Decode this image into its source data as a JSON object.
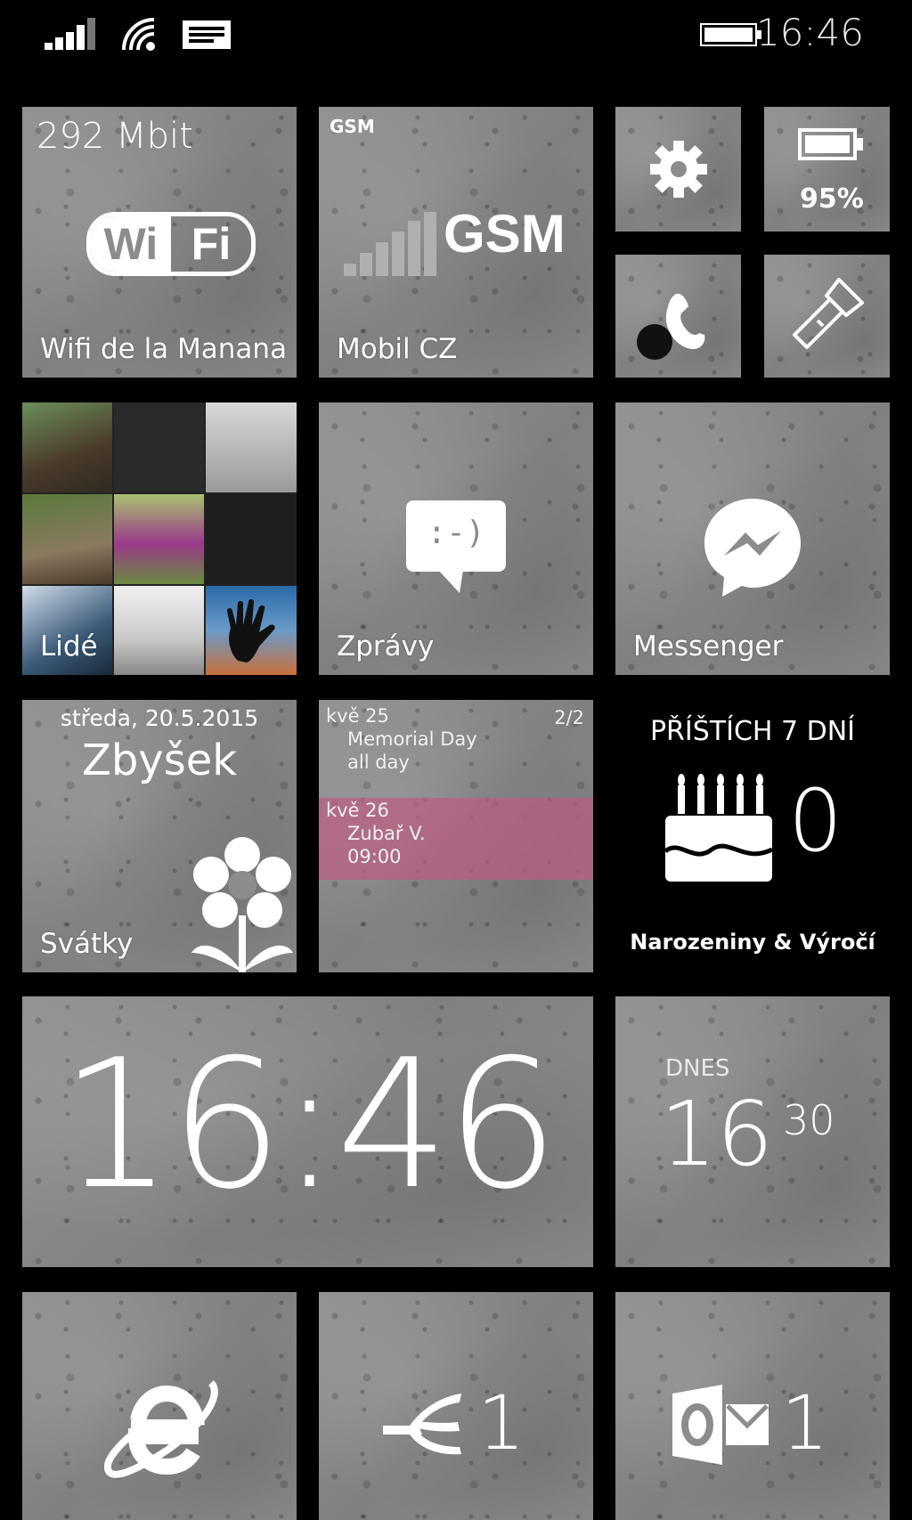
{
  "status_bar": {
    "time": "16:46",
    "icons": [
      "signal-bars-icon",
      "wifi-icon",
      "message-icon",
      "battery-icon"
    ]
  },
  "tiles": {
    "wifi": {
      "speed": "292 Mbit",
      "logo_left": "Wi",
      "logo_right": "Fi",
      "label": "Wifi de la Manana"
    },
    "gsm": {
      "corner": "GSM",
      "big": "GSM",
      "label": "Mobil CZ"
    },
    "settings": {
      "icon": "gear-icon"
    },
    "battery": {
      "percent": "95%"
    },
    "phone": {
      "icon": "phone-icon"
    },
    "flashlight": {
      "icon": "flashlight-icon"
    },
    "photos": {
      "label": "Lidé"
    },
    "messages": {
      "emoticon": ":-)",
      "label": "Zprávy"
    },
    "messenger": {
      "label": "Messenger"
    },
    "namedays": {
      "date": "středa, 20.5.2015",
      "name": "Zbyšek",
      "label": "Svátky"
    },
    "calendar": {
      "page": "2/2",
      "rows": [
        {
          "day": "kvě 25",
          "title": "Memorial Day",
          "time": "all day"
        },
        {
          "day": "kvě 26",
          "title": "Zubař V.",
          "time": "09:00"
        }
      ],
      "highlight_color": "#b0607e"
    },
    "birthdays": {
      "heading": "PŘÍŠTÍCH 7 DNÍ",
      "count": "0",
      "label": "Narozeniny & Výročí"
    },
    "clock": {
      "time": "16:46"
    },
    "sunset": {
      "heading": "DNES",
      "hour": "16",
      "minute": "30"
    },
    "ie": {
      "icon": "internet-explorer-icon"
    },
    "email": {
      "count": "1"
    },
    "outlook": {
      "count": "1"
    }
  },
  "colors": {
    "tile": "#8c8c8c",
    "background": "#000000"
  }
}
